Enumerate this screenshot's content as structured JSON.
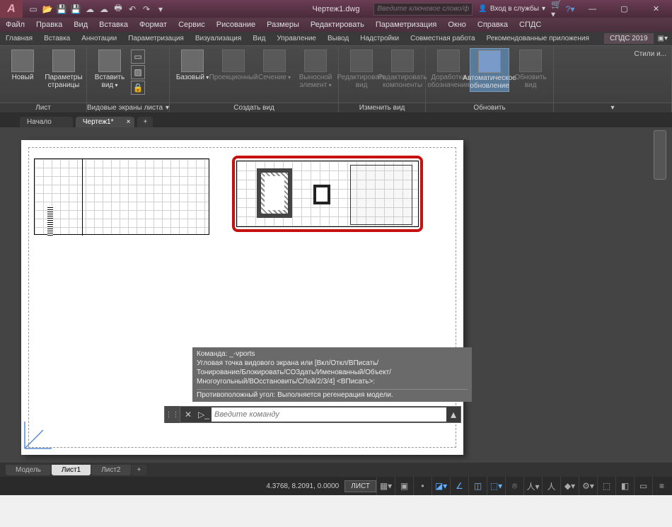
{
  "title": {
    "filename": "Чертеж1.dwg",
    "logo": "A"
  },
  "search_placeholder": "Введите ключевое слово/фразу",
  "login": {
    "text": "Вход в службы",
    "icon": "👤"
  },
  "menu": [
    "Файл",
    "Правка",
    "Вид",
    "Вставка",
    "Формат",
    "Сервис",
    "Рисование",
    "Размеры",
    "Редактировать",
    "Параметризация",
    "Окно",
    "Справка",
    "СПДС"
  ],
  "ribbon_tabs": [
    "Главная",
    "Вставка",
    "Аннотации",
    "Параметризация",
    "Визуализация",
    "Вид",
    "Управление",
    "Вывод",
    "Надстройки",
    "Совместная работа",
    "Рекомендованные приложения"
  ],
  "ribbon_spds": "СПДС 2019",
  "panels": {
    "layout": {
      "title": "Лист",
      "new": "Новый",
      "page": "Параметры\nстраницы"
    },
    "viewports": {
      "title": "Видовые экраны листа",
      "insert": "Вставить вид"
    },
    "create": {
      "title": "Создать вид",
      "base": "Базовый",
      "proj": "Проекционный",
      "section": "Сечение",
      "detail": "Выносной элемент"
    },
    "edit": {
      "title": "Изменить вид",
      "editview": "Редактировать\nвид",
      "editcomp": "Редактировать\nкомпоненты"
    },
    "refresh": {
      "title": "Обновить",
      "fix": "Доработка\nобозначения",
      "auto": "Автоматическое\nобновление",
      "update": "Обновить\nвид"
    },
    "styles": {
      "label": "Стили и..."
    }
  },
  "doctabs": {
    "start": "Начало",
    "file": "Чертеж1*"
  },
  "cmd_history": [
    "Команда: _-vports",
    "Угловая точка видового экрана или [Вкл/Откл/ВПисать/",
    "Тонирование/Блокировать/СОЗдать/Именованный/Объект/",
    "Многоугольный/ВОсстановить/СЛой/2/3/4] <ВПисать>:",
    "Противоположный угол: Выполняется регенерация модели."
  ],
  "cmdline": {
    "placeholder": "Введите команду"
  },
  "layouttabs": {
    "model": "Модель",
    "l1": "Лист1",
    "l2": "Лист2"
  },
  "status": {
    "coords": "4.3768, 8.2091, 0.0000",
    "mode": "ЛИСТ"
  }
}
